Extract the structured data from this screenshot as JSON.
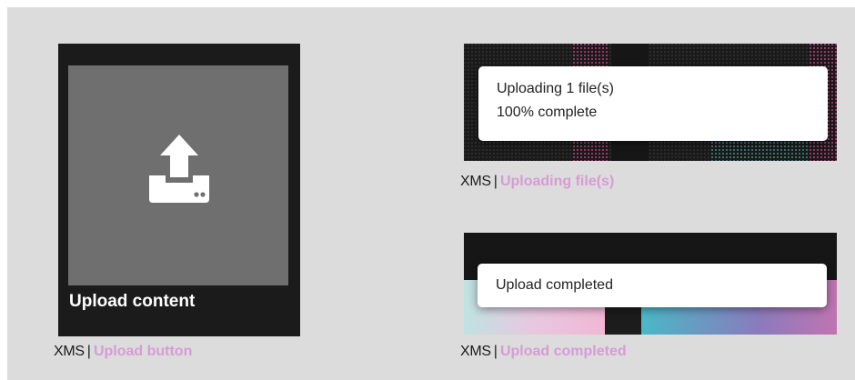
{
  "tiles": {
    "upload_button": {
      "label": "Upload content",
      "icon": "upload-tray-icon"
    }
  },
  "toasts": {
    "uploading": {
      "line1": "Uploading 1 file(s)",
      "line2": "100% complete"
    },
    "completed": {
      "line1": "Upload completed"
    }
  },
  "captions": {
    "upload_button": {
      "brand": "XMS",
      "sep": "|",
      "link": "Upload button"
    },
    "uploading": {
      "brand": "XMS",
      "sep": "|",
      "link": "Uploading file(s)"
    },
    "completed": {
      "brand": "XMS",
      "sep": "|",
      "link": "Upload completed"
    }
  },
  "colors": {
    "stage_bg": "#dcdcdc",
    "tile_bg": "#1b1b1b",
    "tile_image": "#6f6f6f",
    "link": "#d79bd6",
    "pink": "#e27fb8",
    "teal": "#5bbcc7"
  }
}
